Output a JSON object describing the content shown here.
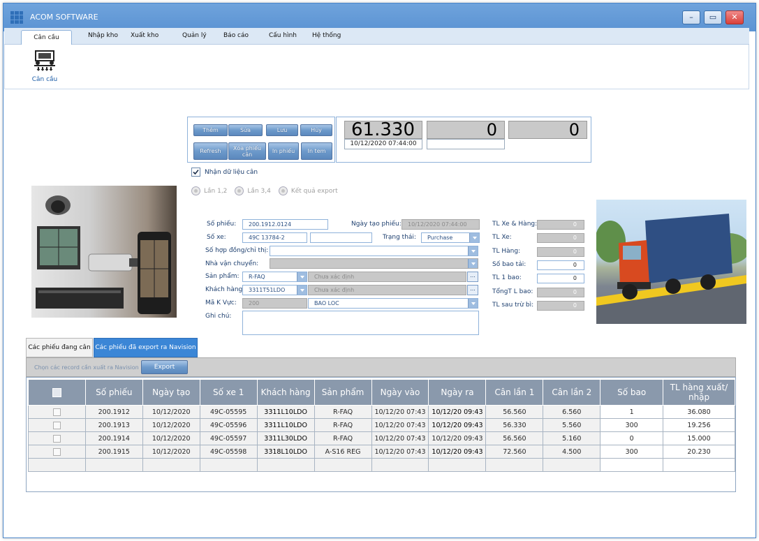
{
  "window": {
    "title": "ACOM SOFTWARE",
    "minimize": "–",
    "maximize": "▭",
    "close": "✕"
  },
  "menu": {
    "tabs": [
      "Cân cầu",
      "Nhập kho",
      "Xuất kho",
      "Quản lý",
      "Báo cáo",
      "Cấu hình",
      "Hệ thống"
    ],
    "active": "Cân cầu"
  },
  "ribbon": {
    "tool_label": "Cân cầu"
  },
  "toolbar": {
    "add": "Thêm",
    "edit": "Sửa",
    "save": "Lưu",
    "cancel": "Hủy",
    "refresh": "Refresh",
    "delete_ticket": "Xóa phiếu cân",
    "print_ticket": "In phiếu",
    "print_stamp": "In tem"
  },
  "weights": {
    "main": "61.330",
    "timestamp": "10/12/2020 07:44:00",
    "second": "0",
    "third": "0"
  },
  "receive_data": {
    "label": "Nhận dữ liệu cân",
    "checked": true
  },
  "radios": [
    "Lần 1,2",
    "Lần 3,4",
    "Kết quả export"
  ],
  "form": {
    "ticket_no_label": "Số phiếu:",
    "ticket_no": "200.1912.0124",
    "created_label": "Ngày tạo phiếu:",
    "created": "10/12/2020 07:44:00",
    "plate_label": "Số xe:",
    "plate": "49C 13784-2",
    "plate2": "",
    "status_label": "Trạng thái:",
    "status": "Purchase",
    "contract_label": "Số hợp đồng/chỉ thị:",
    "contract": "",
    "carrier_label": "Nhà vận chuyển:",
    "carrier": "",
    "product_label": "Sản phẩm:",
    "product": "R-FAQ",
    "product_name": "Chưa xác định",
    "customer_label": "Khách hàng:",
    "customer": "3311T51LDO",
    "customer_name": "Chưa xác định",
    "region_label": "Mã K Vực:",
    "region": "200",
    "region_name": "BAO LOC",
    "note_label": "Ghi chú:",
    "note": ""
  },
  "stats": [
    {
      "label": "TL Xe & Hàng:",
      "value": "0",
      "disabled": true
    },
    {
      "label": "TL Xe:",
      "value": "0",
      "disabled": true
    },
    {
      "label": "TL Hàng:",
      "value": "0",
      "disabled": true
    },
    {
      "label": "Số bao tải:",
      "value": "0",
      "disabled": false
    },
    {
      "label": "TL 1 bao:",
      "value": "0",
      "disabled": false
    },
    {
      "label": "TổngT L bao:",
      "value": "0",
      "disabled": true
    },
    {
      "label": "TL sau trừ bì:",
      "value": "0",
      "disabled": true
    }
  ],
  "tabs": {
    "active_list": "Các phiếu đang cân",
    "exported": "Các phiếu đã export ra Navision"
  },
  "grid_toolbar": {
    "hint": "Chọn các record cần xuất ra Navision",
    "export": "Export"
  },
  "grid": {
    "headers": [
      "",
      "Số phiếu",
      "Ngày tạo",
      "Số xe 1",
      "Khách hàng",
      "Sản phẩm",
      "Ngày vào",
      "Ngày ra",
      "Cân lần 1",
      "Cân lần 2",
      "Số bao",
      "TL hàng xuất/ nhập"
    ],
    "rows": [
      [
        "",
        "200.1912",
        "10/12/2020",
        "49C-05595",
        "3311L10LDO",
        "R-FAQ",
        "10/12/20 07:43",
        "10/12/20 09:43",
        "56.560",
        "6.560",
        "1",
        "36.080"
      ],
      [
        "",
        "200.1913",
        "10/12/2020",
        "49C-05596",
        "3311L10LDO",
        "R-FAQ",
        "10/12/20 07:43",
        "10/12/20 09:43",
        "56.330",
        "5.560",
        "300",
        "19.256"
      ],
      [
        "",
        "200.1914",
        "10/12/2020",
        "49C-05597",
        "3311L30LDO",
        "R-FAQ",
        "10/12/20 07:43",
        "10/12/20 09:43",
        "56.560",
        "5.160",
        "0",
        "15.000"
      ],
      [
        "",
        "200.1915",
        "10/12/2020",
        "49C-05598",
        "3318L10LDO",
        "A-S16 REG",
        "10/12/20 07:43",
        "10/12/20 09:43",
        "72.560",
        "4.500",
        "300",
        "20.230"
      ]
    ]
  },
  "colors": {
    "titlebar": "#5b93d3",
    "accent": "#3b86d6",
    "grid_header": "#8a99ac"
  }
}
